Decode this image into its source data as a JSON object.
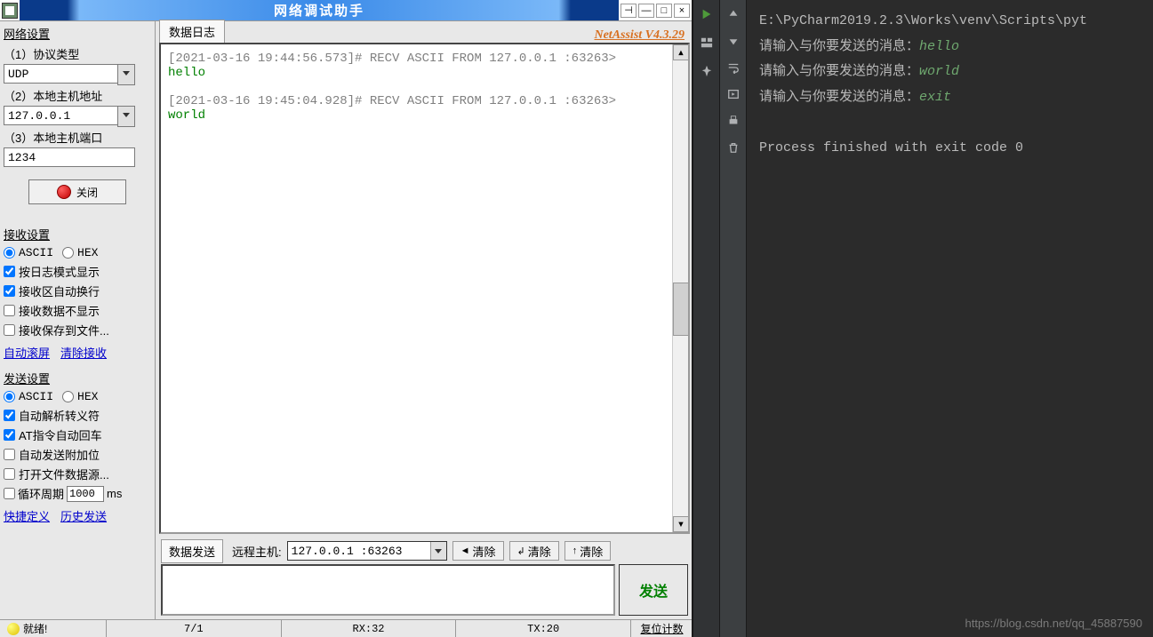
{
  "window": {
    "title": "网络调试助手",
    "version_link": "NetAssist V4.3.29"
  },
  "sidebar": {
    "network_group": "网络设置",
    "protocol_label": "（1）协议类型",
    "protocol_value": "UDP",
    "host_label": "（2）本地主机地址",
    "host_value": "127.0.0.1",
    "port_label": "（3）本地主机端口",
    "port_value": "1234",
    "close_btn": "关闭",
    "recv_group": "接收设置",
    "ascii": "ASCII",
    "hex": "HEX",
    "recv_checks": [
      "按日志模式显示",
      "接收区自动换行",
      "接收数据不显示",
      "接收保存到文件..."
    ],
    "autoscroll": "自动滚屏",
    "clear_recv": "清除接收",
    "send_group": "发送设置",
    "send_checks": [
      "自动解析转义符",
      "AT指令自动回车",
      "自动发送附加位",
      "打开文件数据源..."
    ],
    "cycle_label": "循环周期",
    "cycle_value": "1000",
    "cycle_unit": "ms",
    "quickdef": "快捷定义",
    "history": "历史发送"
  },
  "log": {
    "tab": "数据日志",
    "line1_meta": "[2021-03-16 19:44:56.573]# RECV ASCII FROM 127.0.0.1 :63263>",
    "line1_data": "hello",
    "line2_meta": "[2021-03-16 19:45:04.928]# RECV ASCII FROM 127.0.0.1 :63263>",
    "line2_data": "world"
  },
  "send": {
    "tab": "数据发送",
    "remote_label": "远程主机:",
    "remote_value": "127.0.0.1 :63263",
    "clear": "清除",
    "send_btn": "发送"
  },
  "status": {
    "ready": "就绪!",
    "counter": "7/1",
    "rx": "RX:32",
    "tx": "TX:20",
    "reset": "复位计数"
  },
  "pycharm": {
    "path": "E:\\PyCharm2019.2.3\\Works\\venv\\Scripts\\pyt",
    "prompt": "请输入与你要发送的消息：",
    "inputs": [
      "hello",
      "world",
      "exit"
    ],
    "finished": "Process finished with exit code 0"
  },
  "watermark": "https://blog.csdn.net/qq_45887590"
}
